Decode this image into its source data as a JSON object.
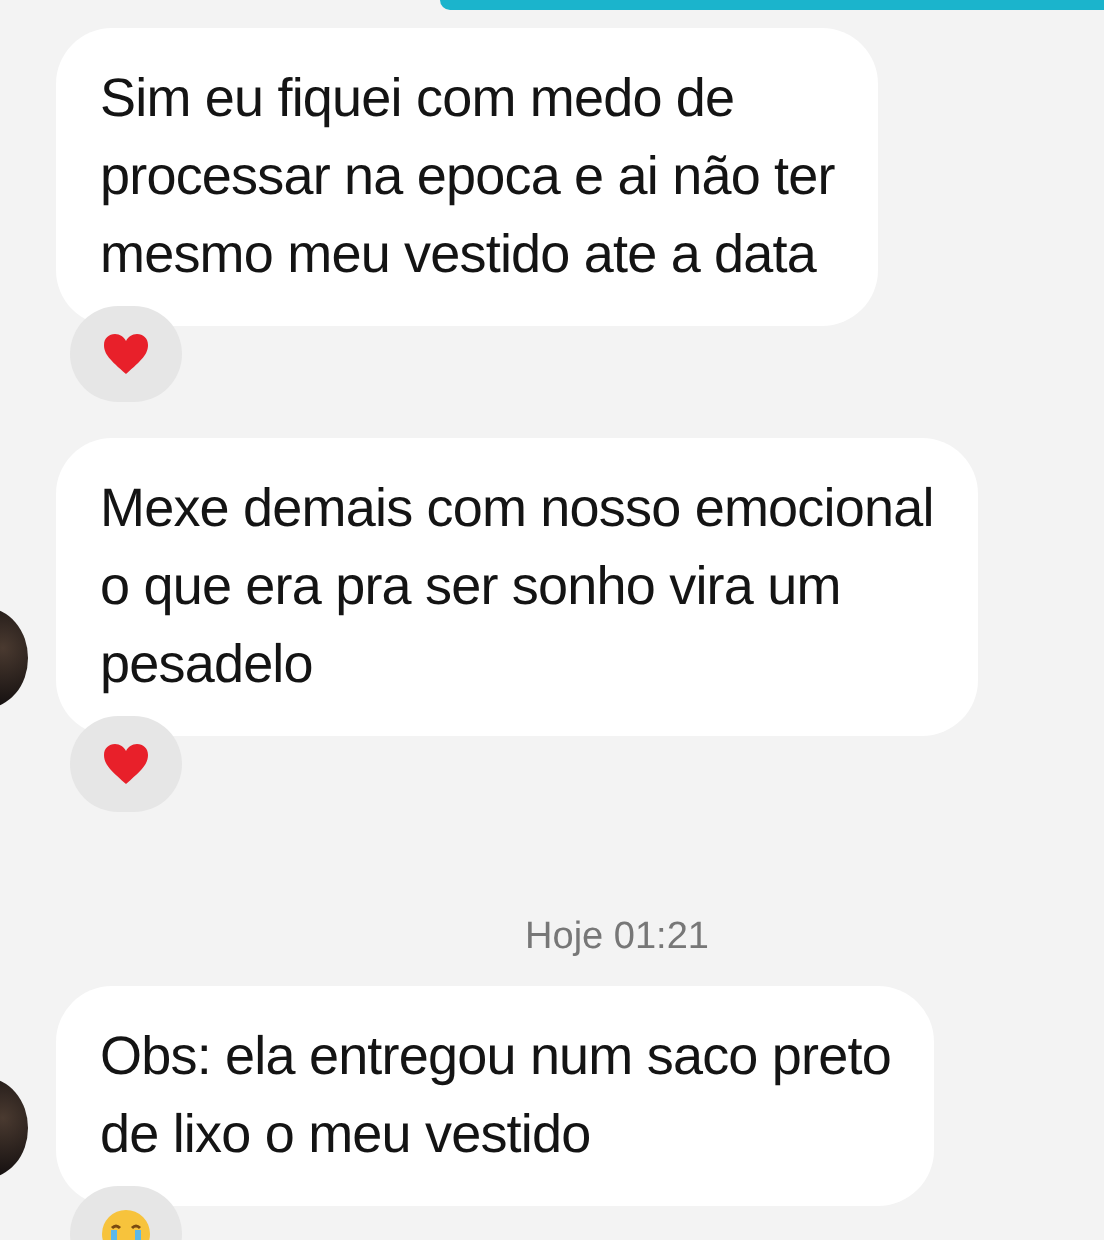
{
  "items": [
    {
      "kind": "message",
      "lines": [
        "Sim eu fiquei com medo de",
        "processar na epoca e ai não ter",
        "mesmo meu vestido ate a data"
      ],
      "avatar": false,
      "reaction": {
        "kind": "heart"
      }
    },
    {
      "kind": "message",
      "lines": [
        "Mexe demais com nosso emocional",
        "o que era pra ser sonho vira um",
        "pesadelo"
      ],
      "avatar": true,
      "reaction": {
        "kind": "heart"
      }
    },
    {
      "kind": "timestamp",
      "text": "Hoje 01:21"
    },
    {
      "kind": "message",
      "lines": [
        "Obs: ela entregou num saco preto",
        "de lixo o meu vestido"
      ],
      "avatar": true,
      "reaction": {
        "kind": "crying"
      }
    }
  ]
}
